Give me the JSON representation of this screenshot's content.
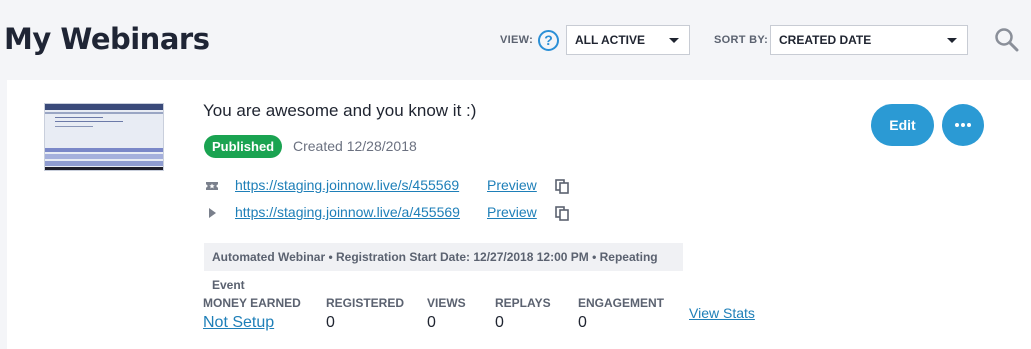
{
  "header": {
    "title": "My Webinars",
    "view_label": "VIEW:",
    "view_help_icon": "?",
    "view_value": "ALL ACTIVE",
    "sort_label": "SORT BY:",
    "sort_value": "CREATED DATE",
    "search_icon": "search-icon"
  },
  "webinar": {
    "title": "You are awesome and you know it :)",
    "status": "Published",
    "status_color": "#1aa351",
    "created": "Created 12/28/2018",
    "links": [
      {
        "icon": "ticket-icon",
        "url": "https://staging.joinnow.live/s/455569",
        "preview": "Preview"
      },
      {
        "icon": "play-icon",
        "url": "https://staging.joinnow.live/a/455569",
        "preview": "Preview"
      }
    ],
    "info": "Automated Webinar • Registration Start Date: 12/27/2018 12:00 PM • Repeating Event",
    "edit_label": "Edit",
    "stats": {
      "money_earned_label": "MONEY EARNED",
      "money_earned_value": "Not Setup",
      "registered_label": "REGISTERED",
      "registered_value": "0",
      "views_label": "VIEWS",
      "views_value": "0",
      "replays_label": "REPLAYS",
      "replays_value": "0",
      "engagement_label": "ENGAGEMENT",
      "engagement_value": "0",
      "view_stats_label": "View Stats"
    }
  },
  "colors": {
    "accent": "#2b9ad4",
    "link": "#1e7fb8"
  }
}
